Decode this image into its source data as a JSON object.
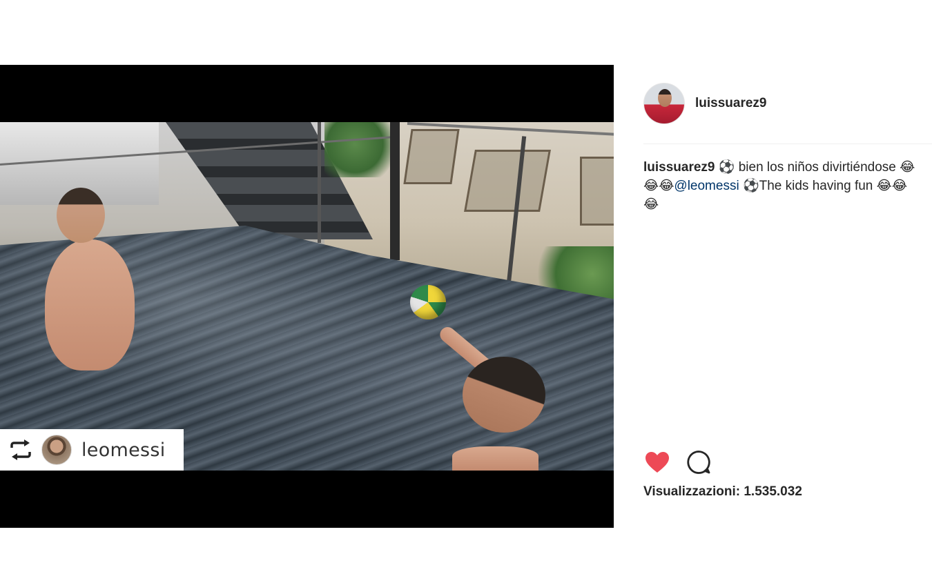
{
  "post": {
    "author": "luissuarez9",
    "avatar_icon": "profile-photo-icon",
    "caption": {
      "username": "luissuarez9",
      "part1": " ⚽ bien los niños divirtiéndose 😂😂😂",
      "mention": "@leomessi",
      "part2": " ⚽The kids having fun 😂😂😂"
    },
    "views_label": "Visualizzazioni:",
    "views_count": "1.535.032",
    "liked": true
  },
  "media": {
    "repost": {
      "icon": "repost-icon",
      "username": "leomessi"
    }
  },
  "colors": {
    "like": "#ed4956",
    "mention": "#003569",
    "text": "#262626",
    "letterbox": "#000000"
  }
}
